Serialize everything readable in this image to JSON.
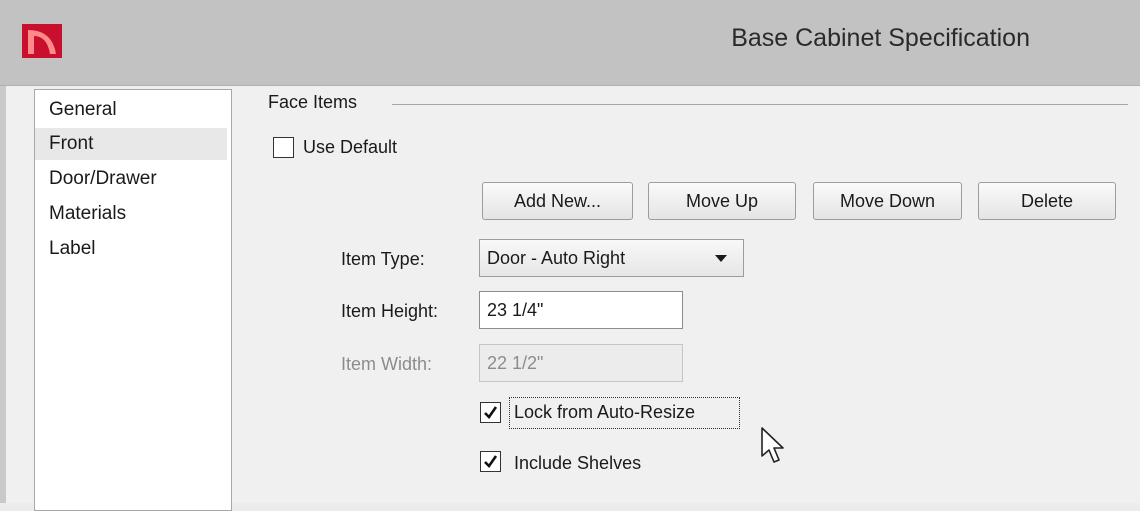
{
  "window": {
    "title": "Base Cabinet Specification",
    "app_icon": "app-logo-icon"
  },
  "nav": {
    "items": [
      {
        "label": "General",
        "selected": false
      },
      {
        "label": "Front",
        "selected": true
      },
      {
        "label": "Door/Drawer",
        "selected": false
      },
      {
        "label": "Materials",
        "selected": false
      },
      {
        "label": "Label",
        "selected": false
      }
    ]
  },
  "face_items": {
    "group_label": "Face Items",
    "use_default": {
      "label": "Use Default",
      "checked": false
    },
    "buttons": {
      "add_new": "Add New...",
      "move_up": "Move Up",
      "move_down": "Move Down",
      "delete": "Delete"
    },
    "item_type": {
      "label": "Item Type:",
      "value": "Door - Auto Right"
    },
    "item_height": {
      "label": "Item Height:",
      "value": "23 1/4\""
    },
    "item_width": {
      "label": "Item Width:",
      "value": "22 1/2\"",
      "disabled": true
    },
    "lock_auto_resize": {
      "label": "Lock from Auto-Resize",
      "checked": true
    },
    "include_shelves": {
      "label": "Include Shelves",
      "checked": true
    }
  }
}
